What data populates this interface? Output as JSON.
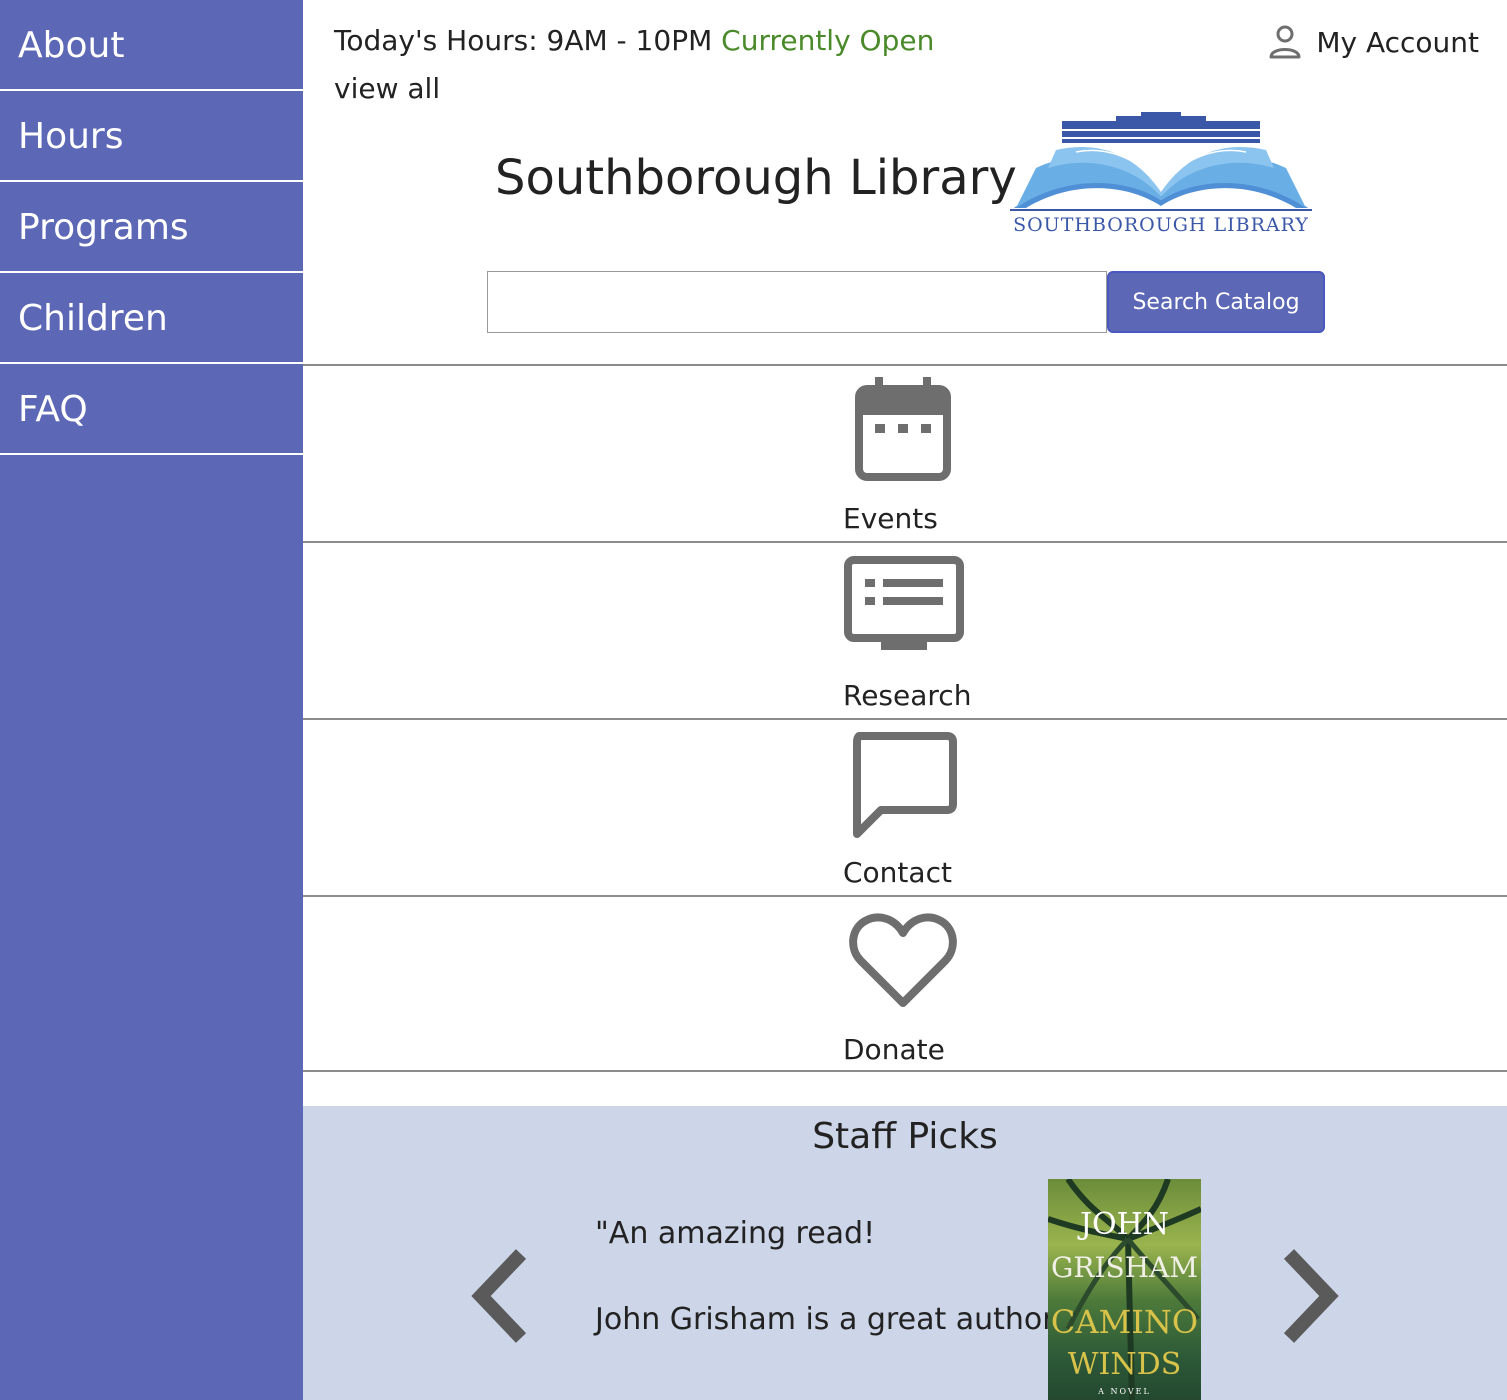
{
  "sidebar": {
    "items": [
      {
        "label": "About"
      },
      {
        "label": "Hours"
      },
      {
        "label": "Programs"
      },
      {
        "label": "Children"
      },
      {
        "label": "FAQ"
      }
    ]
  },
  "header": {
    "hours_label": "Today's Hours: 9AM - 10PM",
    "open_status": "Currently Open",
    "view_all": "view all",
    "account_label": "My Account",
    "site_title": "Southborough Library",
    "logo_text": "SOUTHBOROUGH LIBRARY"
  },
  "search": {
    "value": "",
    "placeholder": "",
    "button_label": "Search Catalog"
  },
  "quick_links": [
    {
      "label": "Events",
      "icon": "calendar-icon"
    },
    {
      "label": "Research",
      "icon": "monitor-list-icon"
    },
    {
      "label": "Contact",
      "icon": "speech-bubble-icon"
    },
    {
      "label": "Donate",
      "icon": "heart-icon"
    }
  ],
  "staff_picks": {
    "title": "Staff Picks",
    "quote_line1": "\"An amazing read!",
    "quote_line2": "John Grisham is a great author.\"",
    "book": {
      "author_line1": "JOHN",
      "author_line2": "GRISHAM",
      "title_line1": "CAMINO",
      "title_line2": "WINDS",
      "subtitle": "A NOVEL"
    }
  },
  "colors": {
    "sidebar": "#5c67b5",
    "open_status": "#4a8a2a",
    "staff_picks_bg": "#cdd5e8",
    "icon_gray": "#6e6e6e"
  }
}
